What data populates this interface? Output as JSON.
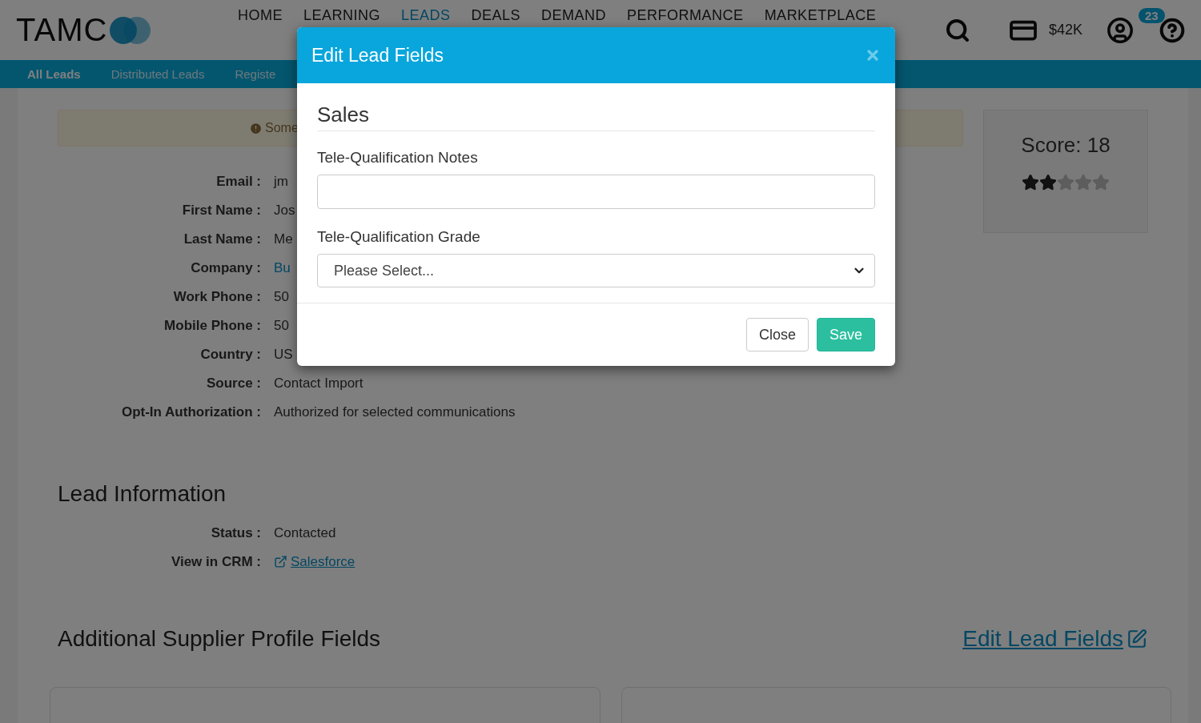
{
  "header": {
    "logo": "TAMC",
    "nav": [
      {
        "label": "HOME",
        "selected": false
      },
      {
        "label": "LEARNING",
        "selected": false
      },
      {
        "label": "LEADS",
        "selected": true
      },
      {
        "label": "DEALS",
        "selected": false
      },
      {
        "label": "DEMAND",
        "selected": false
      },
      {
        "label": "PERFORMANCE",
        "selected": false
      },
      {
        "label": "MARKETPLACE",
        "selected": false
      }
    ],
    "credit": "$42K",
    "notifications": "23"
  },
  "subnav": [
    {
      "label": "All Leads",
      "selected": true
    },
    {
      "label": "Distributed Leads",
      "selected": false
    },
    {
      "label": "Registe",
      "selected": false
    }
  ],
  "notice": "Some",
  "contact_fields": [
    {
      "label": "Email :",
      "value": "jm",
      "kind": "text"
    },
    {
      "label": "First Name :",
      "value": "Jos",
      "kind": "text"
    },
    {
      "label": "Last Name :",
      "value": "Me",
      "kind": "text"
    },
    {
      "label": "Company :",
      "value": "Bu",
      "kind": "link"
    },
    {
      "label": "Work Phone :",
      "value": "50",
      "kind": "text"
    },
    {
      "label": "Mobile Phone :",
      "value": "50",
      "kind": "text"
    },
    {
      "label": "Country :",
      "value": "US",
      "kind": "text"
    },
    {
      "label": "Source :",
      "value": "Contact Import",
      "kind": "text"
    },
    {
      "label": "Opt-In Authorization :",
      "value": "Authorized for selected communications",
      "kind": "text"
    }
  ],
  "score": {
    "label": "Score: 18",
    "stars": 2
  },
  "lead_information": {
    "title": "Lead Information",
    "fields": [
      {
        "label": "Status :",
        "value": "Contacted",
        "kind": "text"
      },
      {
        "label": "View in CRM :",
        "value": "Salesforce",
        "kind": "link"
      }
    ]
  },
  "supplier_profile": {
    "title": "Additional Supplier Profile Fields",
    "edit_link": "Edit Lead Fields"
  },
  "modal": {
    "title": "Edit Lead Fields",
    "section": "Sales",
    "notes_label": "Tele-Qualification Notes",
    "grade_label": "Tele-Qualification Grade",
    "grade_placeholder": "Please Select...",
    "buttons": [
      {
        "label": "Close",
        "kind": "default"
      },
      {
        "label": "Save",
        "kind": "primary"
      }
    ]
  }
}
